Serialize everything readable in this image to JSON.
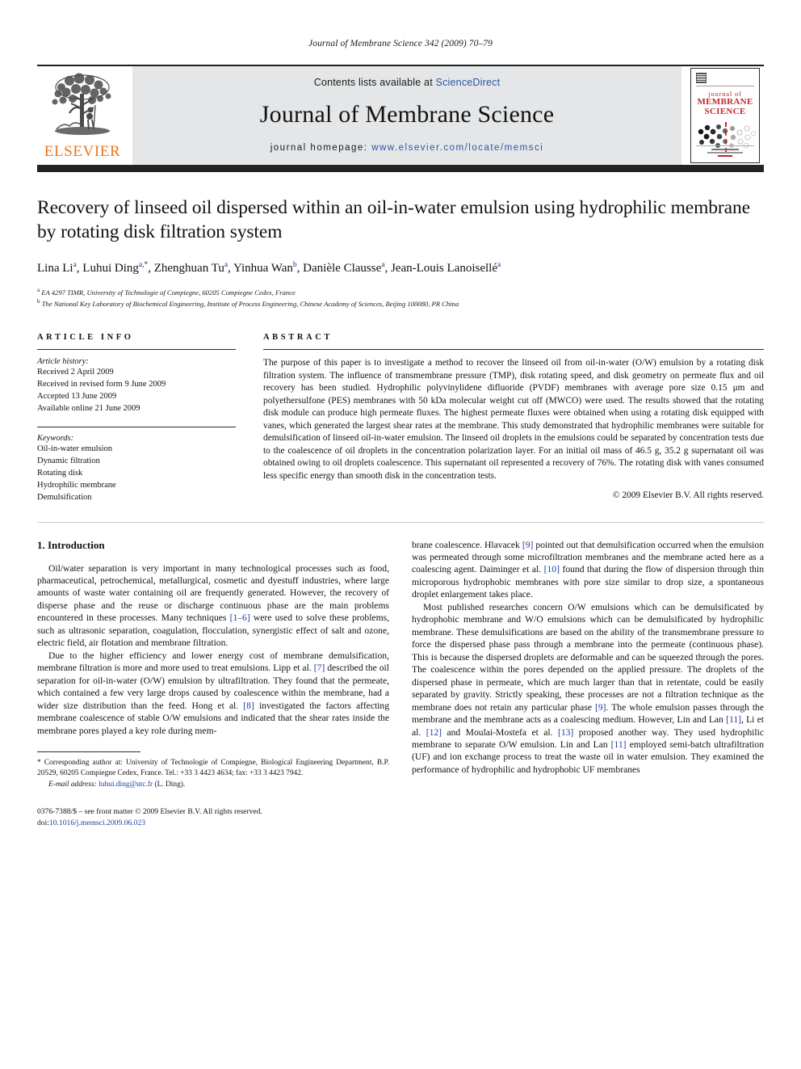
{
  "running_head": "Journal of Membrane Science 342 (2009) 70–79",
  "masthead": {
    "publisher_name": "ELSEVIER",
    "contents_prefix": "Contents lists available at ",
    "contents_link": "ScienceDirect",
    "journal_name": "Journal of Membrane Science",
    "homepage_prefix": "journal homepage: ",
    "homepage_url": "www.elsevier.com/locate/memsci",
    "cover": {
      "line1": "journal of",
      "line2": "MEMBRANE",
      "line3": "SCIENCE"
    }
  },
  "article": {
    "title": "Recovery of linseed oil dispersed within an oil-in-water emulsion using hydrophilic membrane by rotating disk filtration system",
    "authors_html": "Lina Li<sup>a</sup>, Luhui Ding<sup>a,*</sup>, Zhenghuan Tu<sup>a</sup>, Yinhua Wan<sup>b</sup>, Danièle Clausse<sup>a</sup>, Jean-Louis Lanoisellé<sup>a</sup>",
    "affiliations": [
      "EA 4297 TIMR, University of Technologie of Compiegne, 60205 Compiegne Cedex, France",
      "The National Key Laboratory of Biochemical Engineering, Institute of Process Engineering, Chinese Academy of Sciences, Beijing 100080, PR China"
    ],
    "affiliation_marks": [
      "a",
      "b"
    ]
  },
  "article_info": {
    "heading": "ARTICLE INFO",
    "history_label": "Article history:",
    "history": [
      "Received 2 April 2009",
      "Received in revised form 9 June 2009",
      "Accepted 13 June 2009",
      "Available online 21 June 2009"
    ],
    "keywords_label": "Keywords:",
    "keywords": [
      "Oil-in-water emulsion",
      "Dynamic filtration",
      "Rotating disk",
      "Hydrophilic membrane",
      "Demulsification"
    ]
  },
  "abstract": {
    "heading": "ABSTRACT",
    "text": "The purpose of this paper is to investigate a method to recover the linseed oil from oil-in-water (O/W) emulsion by a rotating disk filtration system. The influence of transmembrane pressure (TMP), disk rotating speed, and disk geometry on permeate flux and oil recovery has been studied. Hydrophilic polyvinylidene difluoride (PVDF) membranes with average pore size 0.15 μm and polyethersulfone (PES) membranes with 50 kDa molecular weight cut off (MWCO) were used. The results showed that the rotating disk module can produce high permeate fluxes. The highest permeate fluxes were obtained when using a rotating disk equipped with vanes, which generated the largest shear rates at the membrane. This study demonstrated that hydrophilic membranes were suitable for demulsification of linseed oil-in-water emulsion. The linseed oil droplets in the emulsions could be separated by concentration tests due to the coalescence of oil droplets in the concentration polarization layer. For an initial oil mass of 46.5 g, 35.2 g supernatant oil was obtained owing to oil droplets coalescence. This supernatant oil represented a recovery of 76%. The rotating disk with vanes consumed less specific energy than smooth disk in the concentration tests.",
    "copyright": "© 2009 Elsevier B.V. All rights reserved."
  },
  "introduction": {
    "heading": "1. Introduction",
    "left_paragraphs": [
      "Oil/water separation is very important in many technological processes such as food, pharmaceutical, petrochemical, metallurgical, cosmetic and dyestuff industries, where large amounts of waste water containing oil are frequently generated. However, the recovery of disperse phase and the reuse or discharge continuous phase are the main problems encountered in these processes. Many techniques [1–6] were used to solve these problems, such as ultrasonic separation, coagulation, flocculation, synergistic effect of salt and ozone, electric field, air flotation and membrane filtration.",
      "Due to the higher efficiency and lower energy cost of membrane demulsification, membrane filtration is more and more used to treat emulsions. Lipp et al. [7] described the oil separation for oil-in-water (O/W) emulsion by ultrafiltration. They found that the permeate, which contained a few very large drops caused by coalescence within the membrane, had a wider size distribution than the feed. Hong et al. [8] investigated the factors affecting membrane coalescence of stable O/W emulsions and indicated that the shear rates inside the membrane pores played a key role during mem-"
    ],
    "right_paragraphs": [
      "brane coalescence. Hlavacek [9] pointed out that demulsification occurred when the emulsion was permeated through some microfiltration membranes and the membrane acted here as a coalescing agent. Daiminger et al. [10] found that during the flow of dispersion through thin microporous hydrophobic membranes with pore size similar to drop size, a spontaneous droplet enlargement takes place.",
      "Most published researches concern O/W emulsions which can be demulsificated by hydrophobic membrane and W/O emulsions which can be demulsificated by hydrophilic membrane. These demulsifications are based on the ability of the transmembrane pressure to force the dispersed phase pass through a membrane into the permeate (continuous phase). This is because the dispersed droplets are deformable and can be squeezed through the pores. The coalescence within the pores depended on the applied pressure. The droplets of the dispersed phase in permeate, which are much larger than that in retentate, could be easily separated by gravity. Strictly speaking, these processes are not a filtration technique as the membrane does not retain any particular phase [9]. The whole emulsion passes through the membrane and the membrane acts as a coalescing medium. However, Lin and Lan [11], Li et al. [12] and Moulai-Mostefa et al. [13] proposed another way. They used hydrophilic membrane to separate O/W emulsion. Lin and Lan [11] employed semi-batch ultrafiltration (UF) and ion exchange process to treat the waste oil in water emulsion. They examined the performance of hydrophilic and hydrophobic UF membranes"
    ]
  },
  "footnote": {
    "corresponding_marker": "*",
    "corresponding_text": "Corresponding author at: University of Technologie of Compiegne, Biological Engineering Department, B.P. 20529, 60205 Compiegne Cedex, France. Tel.: +33 3 4423 4634; fax: +33 3 4423 7942.",
    "email_label": "E-mail address:",
    "email": "luhui.ding@utc.fr",
    "email_suffix": "(L. Ding).",
    "issn_line": "0376-7388/$ – see front matter © 2009 Elsevier B.V. All rights reserved.",
    "doi_label": "doi:",
    "doi_value": "10.1016/j.memsci.2009.06.023"
  },
  "colors": {
    "link_blue": "#1b3fa0",
    "sciencedirect_blue": "#2a56a5",
    "elsevier_orange": "#E87722",
    "cover_red": "#C0272D",
    "rule_dark": "#232323"
  }
}
